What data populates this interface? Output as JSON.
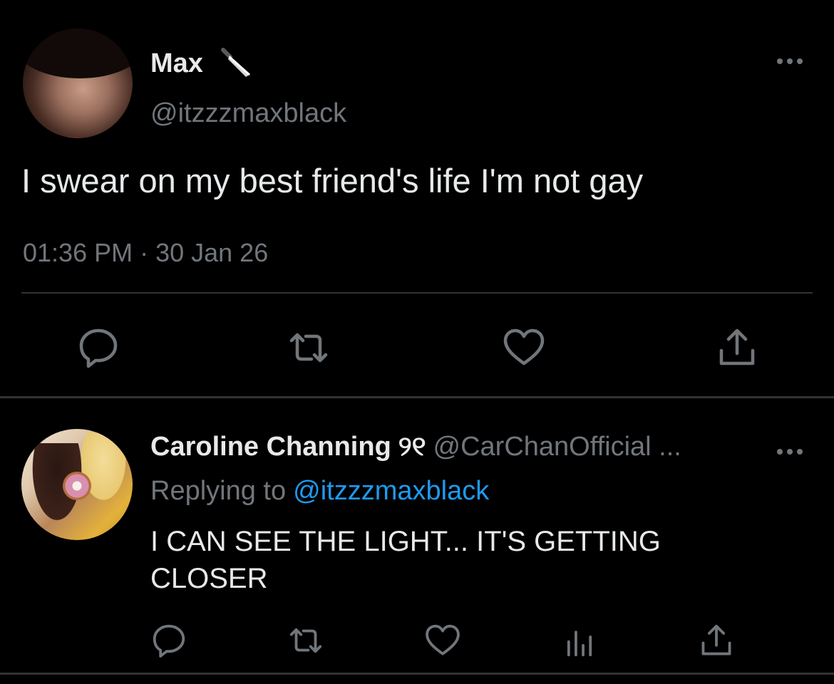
{
  "main_tweet": {
    "author_name": "Max",
    "author_name_icon": "kitchen-knife-icon",
    "author_handle": "@itzzzmaxblack",
    "text": "I swear on my best friend's life I'm not gay",
    "timestamp": "01:36 PM · 30 Jan 26",
    "actions": [
      "reply-icon",
      "retweet-icon",
      "like-icon",
      "share-icon"
    ],
    "more_icon": "more-horizontal-icon"
  },
  "reply_tweet": {
    "author_name": "Caroline Channing",
    "author_emoji": "୨୧",
    "author_handle": "@CarChanOfficial ...",
    "replying_label": "Replying to",
    "replying_to": "@itzzzmaxblack",
    "text": "I CAN SEE THE LIGHT... IT'S GETTING CLOSER",
    "actions": [
      "reply-icon",
      "retweet-icon",
      "like-icon",
      "analytics-icon",
      "share-icon"
    ],
    "more_icon": "more-horizontal-icon"
  },
  "colors": {
    "background": "#000000",
    "text_primary": "#e7e9ea",
    "text_secondary": "#71767b",
    "link": "#1d9bf0",
    "divider": "#2f3336"
  }
}
